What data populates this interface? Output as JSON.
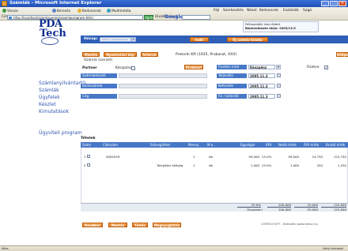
{
  "browser": {
    "title": "Számlák - Microsoft Internet Explorer",
    "menu": [
      "Fájl",
      "Szerkesztés",
      "Nézet",
      "Kedvencek",
      "Eszközök",
      "Súgó"
    ],
    "toolbar": [
      "Vissza",
      "Keresés",
      "Kedvencek",
      "Multimédia"
    ],
    "address_label": "Cím",
    "address_value": "http://localhost/szamlaverzio/szamlaprogram.html",
    "go_label": "Ugrás",
    "links_label": "Hivatkozások",
    "google_label": "Google"
  },
  "logo": {
    "line1": "PDA",
    "line2": "Tech"
  },
  "user": {
    "line1": "Felhasználó: Ivan Aldert",
    "line2": "Bejelentkezés ideje: 2005/11/3"
  },
  "month_bar": {
    "label": "Hónap:",
    "selected": "Nincs kiválasztva",
    "new_button": "Indít",
    "list_button": "Új számla kiadás"
  },
  "sidebar": {
    "items": [
      "Számlanyilvántartó",
      "Számlák",
      "Ügyfelek",
      "Készlet",
      "Kimutatások",
      "Ügyviteli program"
    ]
  },
  "actions": {
    "new": "Mentés",
    "print": "Nyomtatási kép",
    "delete": "Sztornó",
    "right": "Kilépés",
    "partner_info": "Pretorik Kft (1035, Prabarat, XXX)"
  },
  "invoice_title": "Számla szerzeti",
  "form": {
    "partner_label": "Partner",
    "cash_label": "Készpénz",
    "select_button": "Kiválaszt",
    "rows_left": [
      "Számlakészlet",
      "Bankszámla",
      "Cég"
    ],
    "rows_right": [
      "Fizetési mód",
      "Teljesítés",
      "Kelteztés",
      "Fiz. határidő"
    ],
    "payment_value": "Készpénz",
    "date1": "2005.11.3",
    "date2": "2005.11.3",
    "date3": "2005.11.3",
    "checkbox_label": "Fizetve"
  },
  "items_title": "Tételek",
  "grid": {
    "headers": [
      "Szám",
      "Cikkszám",
      "Szöveg/tétel",
      "Menny.",
      "M.e.",
      "Egységár",
      "ÁFA",
      "Nettó érték",
      "ÁFA érték",
      "Bruttó érték"
    ],
    "rows": [
      {
        "num": "1",
        "code": "0002059",
        "text": "",
        "qty": "1",
        "unit": "db",
        "price": "99,000",
        "vat": "25.0%",
        "net": "99,000",
        "vatval": "24,750",
        "gross": "123,750"
      },
      {
        "num": "2",
        "code": "",
        "text": "Telepítési költség",
        "qty": "1",
        "unit": "db",
        "price": "1,000",
        "vat": "25.0%",
        "net": "1,000",
        "vatval": "250",
        "gross": "1,250"
      }
    ]
  },
  "summary": {
    "vat": "25.0%",
    "net": "100,000",
    "vatval": "25,000",
    "gross": "125,000",
    "total_label": "Összesen:",
    "net2": "100,000",
    "vatval2": "25,000",
    "gross2": "125,000"
  },
  "footer": {
    "buttons": [
      "Rendben",
      "Mentés",
      "Törlés",
      "Megnyugtatás"
    ],
    "copyright": "COMTECH KFT - fejlesztés (www.nelkul.hu)"
  },
  "status": {
    "left": "Kész",
    "right": "Helyi intranet"
  },
  "colors": {
    "accent": "#2f5fb6",
    "header": "#4778c8",
    "button": "#e58a2c",
    "link": "#2e55b0"
  }
}
